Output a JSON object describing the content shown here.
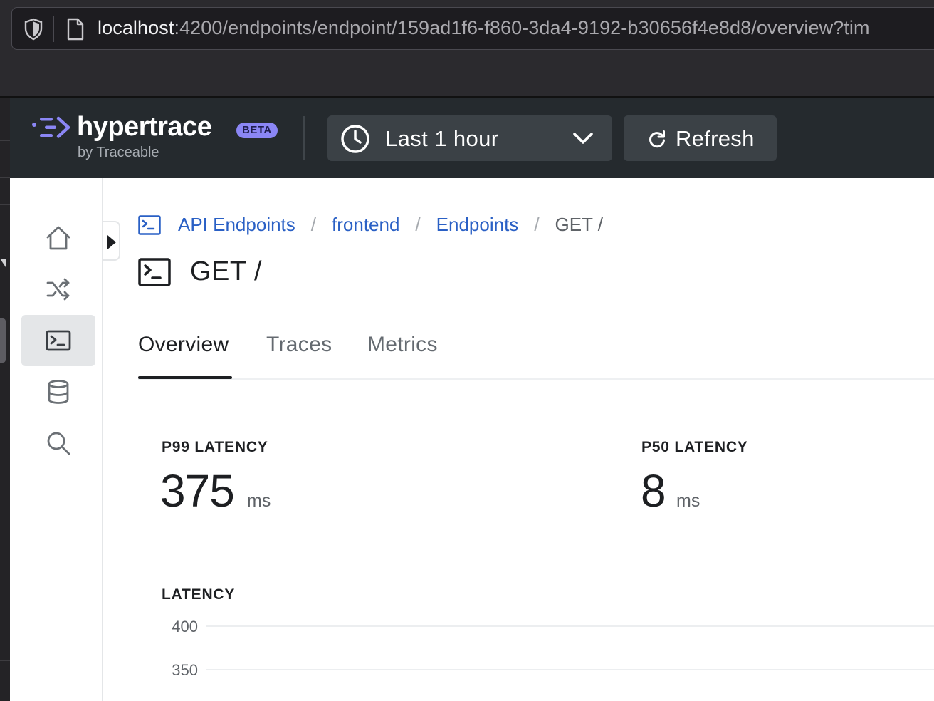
{
  "browser": {
    "url_host": "localhost",
    "url_rest": ":4200/endpoints/endpoint/159ad1f6-f860-3da4-9192-b30656f4e8d8/overview?tim"
  },
  "header": {
    "logo_text": "hypertrace",
    "beta_badge": "BETA",
    "logo_sub": "by Traceable",
    "time_range_label": "Last 1 hour",
    "refresh_label": "Refresh",
    "colors": {
      "header_bg": "#252a2e",
      "button_bg": "#3b4146",
      "brand_accent": "#8b86f5"
    }
  },
  "nav": {
    "items": [
      {
        "name": "home",
        "icon": "home-icon",
        "active": false
      },
      {
        "name": "application-flow",
        "icon": "shuffle-icon",
        "active": false
      },
      {
        "name": "endpoints",
        "icon": "terminal-icon",
        "active": true
      },
      {
        "name": "backends",
        "icon": "database-icon",
        "active": false
      },
      {
        "name": "explorer",
        "icon": "search-icon",
        "active": false
      }
    ]
  },
  "breadcrumb": {
    "items": [
      "API Endpoints",
      "frontend",
      "Endpoints",
      "GET /"
    ],
    "separator": "/"
  },
  "page": {
    "title": "GET /"
  },
  "tabs": {
    "items": [
      "Overview",
      "Traces",
      "Metrics"
    ],
    "active": "Overview"
  },
  "metrics": {
    "p99": {
      "label": "P99 LATENCY",
      "value": "375",
      "unit": "ms"
    },
    "p50": {
      "label": "P50 LATENCY",
      "value": "8",
      "unit": "ms"
    }
  },
  "latency_chart": {
    "title": "LATENCY"
  },
  "chart_data": {
    "type": "line",
    "title": "LATENCY",
    "y_ticks": [
      400,
      350
    ],
    "ylim": [
      350,
      400
    ],
    "grid": true,
    "series": []
  }
}
